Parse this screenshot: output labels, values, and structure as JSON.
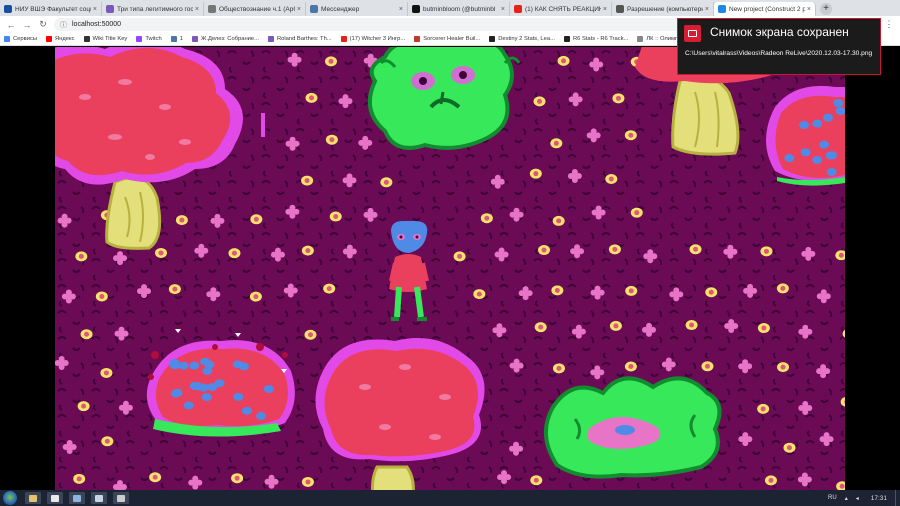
{
  "browser": {
    "tabs": [
      {
        "label": "НИУ ВШЭ Факультет социа",
        "favicon_color": "#1a4fa0",
        "active": false
      },
      {
        "label": "Три типа легитимного гос",
        "favicon_color": "#7a5ab8",
        "active": false
      },
      {
        "label": "Обществознание ч.1 (Арб",
        "favicon_color": "#777777",
        "active": false
      },
      {
        "label": "Мессенджер",
        "favicon_color": "#4a76a8",
        "active": false
      },
      {
        "label": "butminbloom (@butminbl",
        "favicon_color": "#111111",
        "active": false
      },
      {
        "label": "(1) КАК СНЯТЬ РЕАКЦИЮ",
        "favicon_color": "#e62117",
        "active": false
      },
      {
        "label": "Разрешение (компьютерн",
        "favicon_color": "#555555",
        "active": false
      },
      {
        "label": "New project (Construct 2 p",
        "favicon_color": "#1e88e5",
        "active": true
      }
    ],
    "tab_close": "×",
    "new_tab": "+",
    "address": "localhost:50000",
    "menu": "⋮",
    "bookmarks": [
      {
        "label": "Сервисы",
        "color": "#4285f4"
      },
      {
        "label": "Яндекс",
        "color": "#ff0000"
      },
      {
        "label": "Wiki Title Key",
        "color": "#333333"
      },
      {
        "label": "Twitch",
        "color": "#9146ff"
      },
      {
        "label": "1",
        "color": "#4a76a8"
      },
      {
        "label": "Ж.Делез: Собрание...",
        "color": "#7a5ab8"
      },
      {
        "label": "Roland Barthes: Th...",
        "color": "#7a5ab8"
      },
      {
        "label": "(17) Witcher 3 Ингр...",
        "color": "#e62117"
      },
      {
        "label": "Sorcerer Healer Buil...",
        "color": "#c0392b"
      },
      {
        "label": "Destiny 2 Stats, Lea...",
        "color": "#222222"
      },
      {
        "label": "R6 Stats - R6 Track...",
        "color": "#222222"
      },
      {
        "label": "ЛК :: Олимпиа",
        "color": "#888888"
      }
    ]
  },
  "toast": {
    "title": "Снимок экрана сохранен",
    "path": "C:\\Users\\vitalrass\\Videos\\Radeon ReLive\\2020.12.03-17.30.png",
    "accent": "#d71d32"
  },
  "game": {
    "background": "#6b0a55",
    "colors": {
      "foliage_red": "#ea3f5d",
      "foliage_pink": "#e24ae8",
      "trunk": "#e3df7a",
      "green": "#36e85a",
      "blue": "#4f8be6",
      "cross": "#e874c8",
      "dot": "#f6e36a"
    }
  },
  "taskbar": {
    "lang": "RU",
    "time": "17:31",
    "apps": [
      {
        "name": "explorer",
        "color": "#e7c26a"
      },
      {
        "name": "chrome",
        "color": "#e9e9e9"
      },
      {
        "name": "taskview",
        "color": "#8fb3e0"
      },
      {
        "name": "steam",
        "color": "#c7d5e0"
      },
      {
        "name": "settings",
        "color": "#cccccc"
      }
    ]
  }
}
